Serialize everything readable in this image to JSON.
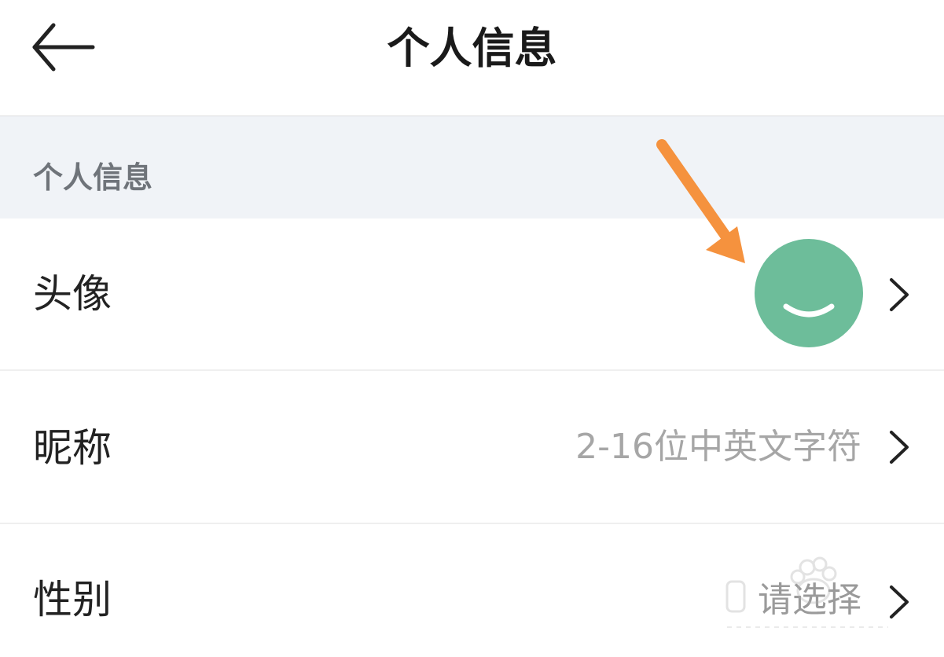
{
  "header": {
    "title": "个人信息",
    "back_icon": "arrow-left-icon"
  },
  "section": {
    "title": "个人信息"
  },
  "rows": [
    {
      "label": "头像",
      "value": "",
      "icon": "avatar-smile-icon"
    },
    {
      "label": "昵称",
      "value": "2-16位中英文字符"
    },
    {
      "label": "性别",
      "value": "请选择"
    }
  ],
  "colors": {
    "avatar_bg": "#6dbd9a",
    "annotation_arrow": "#f5923e",
    "section_bg": "#f0f3f7"
  },
  "icons": [
    "arrow-left-icon",
    "chevron-right-icon",
    "annotation-arrow-icon",
    "watermark-icon"
  ]
}
